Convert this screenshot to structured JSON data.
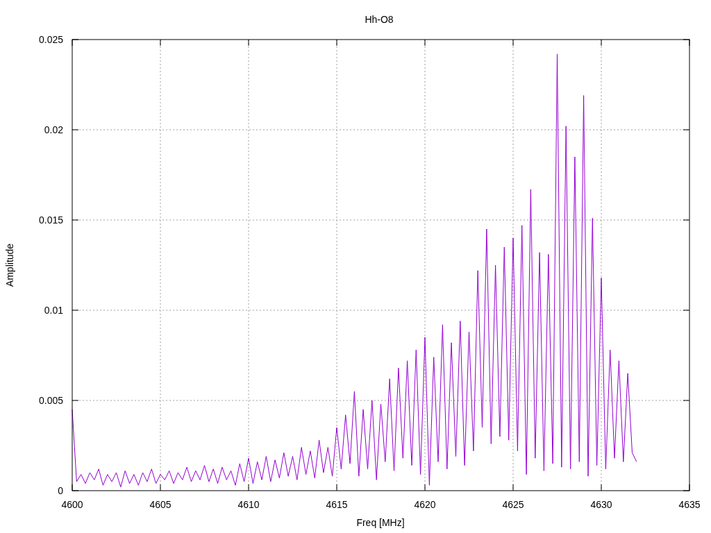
{
  "chart_data": {
    "type": "line",
    "grid": true,
    "title": "Hh-O8",
    "xlabel": "Freq [MHz]",
    "ylabel": "Amplitude",
    "xlim": [
      4600,
      4635
    ],
    "ylim": [
      0,
      0.025
    ],
    "xticks": [
      4600,
      4605,
      4610,
      4615,
      4620,
      4625,
      4630,
      4635
    ],
    "yticks": [
      {
        "value": 0,
        "label": "0"
      },
      {
        "value": 0.005,
        "label": "0.005"
      },
      {
        "value": 0.01,
        "label": "0.01"
      },
      {
        "value": 0.015,
        "label": "0.015"
      },
      {
        "value": 0.02,
        "label": "0.02"
      },
      {
        "value": 0.025,
        "label": "0.025"
      }
    ],
    "x": [
      4600,
      4600.25,
      4600.5,
      4600.75,
      4601,
      4601.25,
      4601.5,
      4601.75,
      4602,
      4602.25,
      4602.5,
      4602.75,
      4603,
      4603.25,
      4603.5,
      4603.75,
      4604,
      4604.25,
      4604.5,
      4604.75,
      4605,
      4605.25,
      4605.5,
      4605.75,
      4606,
      4606.25,
      4606.5,
      4606.75,
      4607,
      4607.25,
      4607.5,
      4607.75,
      4608,
      4608.25,
      4608.5,
      4608.75,
      4609,
      4609.25,
      4609.5,
      4609.75,
      4610,
      4610.25,
      4610.5,
      4610.75,
      4611,
      4611.25,
      4611.5,
      4611.75,
      4612,
      4612.25,
      4612.5,
      4612.75,
      4613,
      4613.25,
      4613.5,
      4613.75,
      4614,
      4614.25,
      4614.5,
      4614.75,
      4615,
      4615.25,
      4615.5,
      4615.75,
      4616,
      4616.25,
      4616.5,
      4616.75,
      4617,
      4617.25,
      4617.5,
      4617.75,
      4618,
      4618.25,
      4618.5,
      4618.75,
      4619,
      4619.25,
      4619.5,
      4619.75,
      4620,
      4620.25,
      4620.5,
      4620.75,
      4621,
      4621.25,
      4621.5,
      4621.75,
      4622,
      4622.25,
      4622.5,
      4622.75,
      4623,
      4623.25,
      4623.5,
      4623.75,
      4624,
      4624.25,
      4624.5,
      4624.75,
      4625,
      4625.25,
      4625.5,
      4625.75,
      4626,
      4626.25,
      4626.5,
      4626.75,
      4627,
      4627.25,
      4627.5,
      4627.75,
      4628,
      4628.25,
      4628.5,
      4628.75,
      4629,
      4629.25,
      4629.5,
      4629.75,
      4630,
      4630.25,
      4630.5,
      4630.75,
      4631,
      4631.25,
      4631.5,
      4631.75,
      4632
    ],
    "series": [
      {
        "color": "#9400d3",
        "values": [
          0.0045,
          0.0005,
          0.0009,
          0.0004,
          0.001,
          0.0006,
          0.0012,
          0.0003,
          0.0009,
          0.0005,
          0.001,
          0.0002,
          0.0011,
          0.0004,
          0.0009,
          0.0003,
          0.001,
          0.0005,
          0.0012,
          0.0004,
          0.0009,
          0.0006,
          0.0011,
          0.0004,
          0.001,
          0.0006,
          0.0013,
          0.0005,
          0.0011,
          0.0006,
          0.0014,
          0.0005,
          0.0012,
          0.0004,
          0.0013,
          0.0006,
          0.0011,
          0.0003,
          0.0015,
          0.0005,
          0.0018,
          0.0004,
          0.0016,
          0.0006,
          0.0019,
          0.0005,
          0.0017,
          0.0007,
          0.0021,
          0.0008,
          0.0019,
          0.0006,
          0.0024,
          0.0009,
          0.0022,
          0.0007,
          0.0028,
          0.001,
          0.0024,
          0.0008,
          0.0035,
          0.0012,
          0.0042,
          0.0015,
          0.0055,
          0.0008,
          0.0045,
          0.0012,
          0.005,
          0.0006,
          0.0048,
          0.0016,
          0.0062,
          0.0011,
          0.0068,
          0.0018,
          0.0072,
          0.0014,
          0.0078,
          0.0009,
          0.0085,
          0.0003,
          0.0074,
          0.0016,
          0.0092,
          0.0012,
          0.0082,
          0.0019,
          0.0094,
          0.0014,
          0.0088,
          0.0022,
          0.0122,
          0.0035,
          0.0145,
          0.0026,
          0.0125,
          0.003,
          0.0135,
          0.0028,
          0.014,
          0.0022,
          0.0147,
          0.0009,
          0.0167,
          0.0018,
          0.0132,
          0.0011,
          0.0131,
          0.0015,
          0.0242,
          0.0013,
          0.0202,
          0.0012,
          0.0185,
          0.0016,
          0.0219,
          0.0008,
          0.0151,
          0.0014,
          0.0118,
          0.0012,
          0.0078,
          0.0018,
          0.0072,
          0.0016,
          0.0065,
          0.0021,
          0.0016
        ]
      }
    ]
  }
}
